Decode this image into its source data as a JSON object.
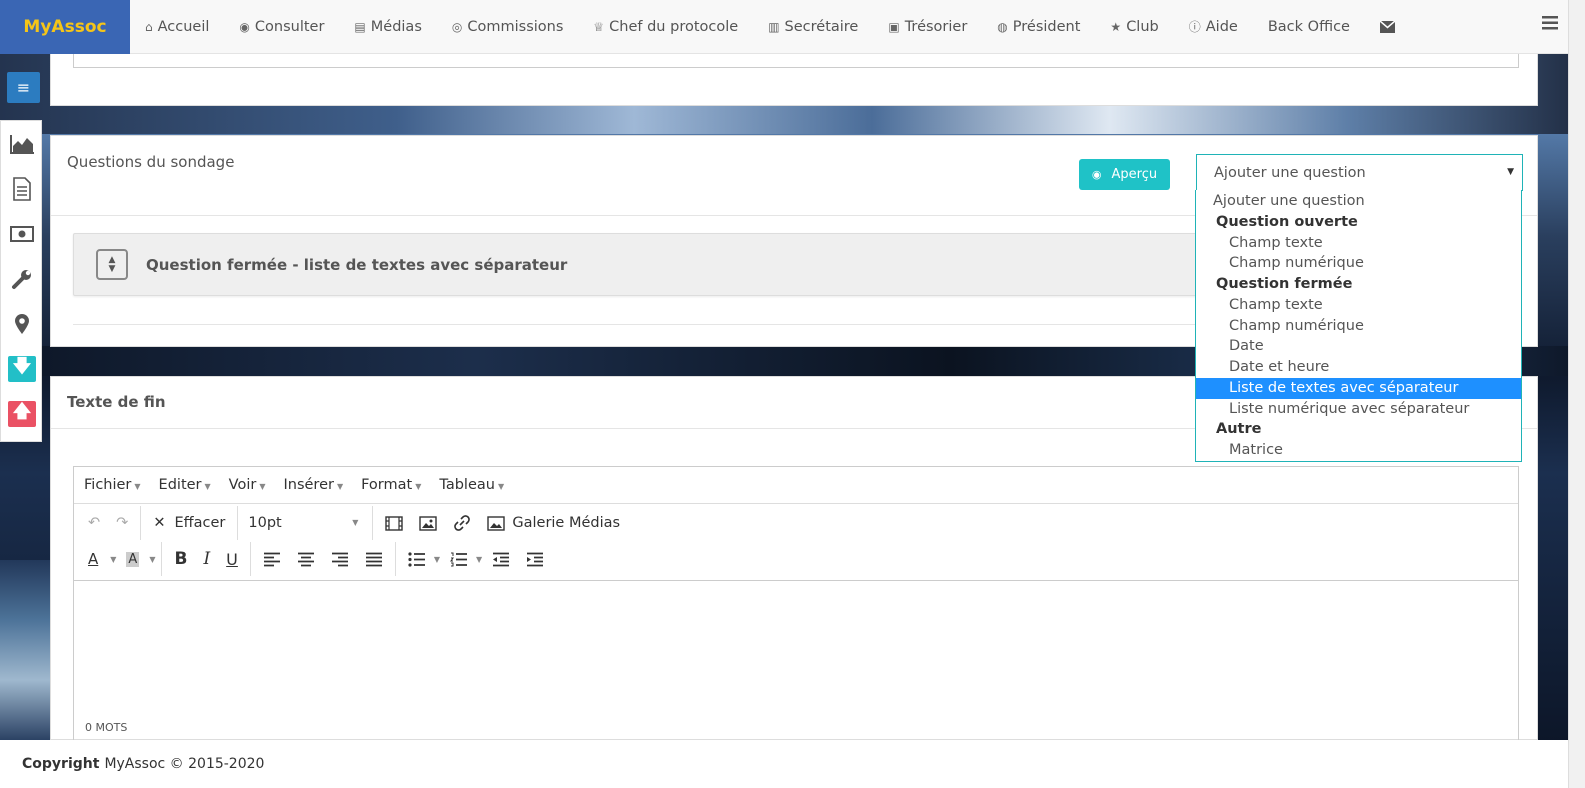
{
  "brand": "MyAssoc",
  "nav": [
    {
      "label": "Accueil",
      "icon": "home-icon",
      "glyph": "⌂"
    },
    {
      "label": "Consulter",
      "icon": "eye-icon",
      "glyph": "◉"
    },
    {
      "label": "Médias",
      "icon": "file-icon",
      "glyph": "▤"
    },
    {
      "label": "Commissions",
      "icon": "user-circle-icon",
      "glyph": "◎"
    },
    {
      "label": "Chef du protocole",
      "icon": "trophy-icon",
      "glyph": "♕"
    },
    {
      "label": "Secrétaire",
      "icon": "book-icon",
      "glyph": "▥"
    },
    {
      "label": "Trésorier",
      "icon": "money-icon",
      "glyph": "▣"
    },
    {
      "label": "Président",
      "icon": "globe-icon",
      "glyph": "◍"
    },
    {
      "label": "Club",
      "icon": "star-icon",
      "glyph": "★"
    },
    {
      "label": "Aide",
      "icon": "info-icon",
      "glyph": "ⓘ"
    },
    {
      "label": "Back Office",
      "icon": "",
      "glyph": ""
    }
  ],
  "questions_panel": {
    "title": "Questions du sondage",
    "apercu_label": "Aperçu",
    "select_value": "Ajouter une question",
    "question_card_label": "Question fermée - liste de textes avec séparateur"
  },
  "dropdown": {
    "placeholder": "Ajouter une question",
    "groups": [
      {
        "label": "Question ouverte",
        "options": [
          "Champ texte",
          "Champ numérique"
        ]
      },
      {
        "label": "Question fermée",
        "options": [
          "Champ texte",
          "Champ numérique",
          "Date",
          "Date et heure",
          "Liste de textes avec séparateur",
          "Liste numérique avec séparateur"
        ]
      },
      {
        "label": "Autre",
        "options": [
          "Matrice"
        ]
      }
    ],
    "selected": "Liste de textes avec séparateur"
  },
  "fin_panel": {
    "title": "Texte de fin",
    "menus": [
      "Fichier",
      "Editer",
      "Voir",
      "Insérer",
      "Format",
      "Tableau"
    ],
    "clear_label": "Effacer",
    "font_size": "10pt",
    "gallery_label": "Galerie Médias",
    "word_count": "0 MOTS"
  },
  "footer": {
    "copyright_label": "Copyright",
    "copyright_text": "MyAssoc © 2015-2020"
  },
  "colors": {
    "brand_bg": "#3a66b4",
    "brand_text": "#f5c518",
    "accent": "#1fc2c7",
    "selected": "#1e90ff",
    "up_button": "#ea5164"
  }
}
